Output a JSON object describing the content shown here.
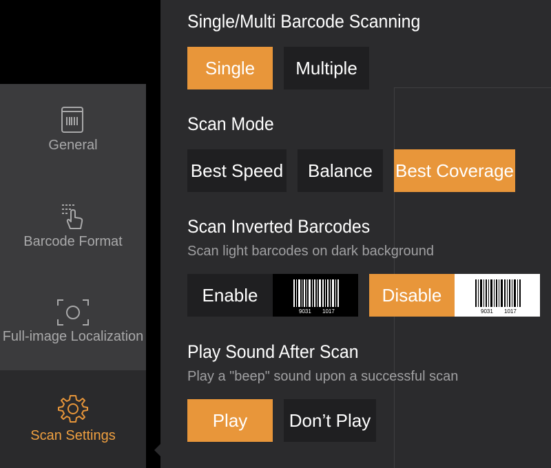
{
  "sidebar": {
    "items": [
      {
        "label": "General",
        "icon": "book-icon"
      },
      {
        "label": "Barcode Format",
        "icon": "tap-barcode-icon"
      },
      {
        "label": "Full-image Localization",
        "icon": "focus-frame-icon"
      },
      {
        "label": "Scan Settings",
        "icon": "gear-icon",
        "active": true
      }
    ]
  },
  "colors": {
    "accent": "#e8963a",
    "button_bg": "#1f1f21",
    "panel_bg": "#2b2b2d",
    "sidebar_bg": "#3b3b3d"
  },
  "sections": {
    "scanning": {
      "title": "Single/Multi Barcode Scanning",
      "options": [
        "Single",
        "Multiple"
      ],
      "selected": "Single"
    },
    "scan_mode": {
      "title": "Scan Mode",
      "options": [
        "Best Speed",
        "Balance",
        "Best Coverage"
      ],
      "selected": "Best Coverage"
    },
    "inverted": {
      "title": "Scan Inverted Barcodes",
      "subtitle": "Scan light barcodes on dark background",
      "options": [
        "Enable",
        "Disable"
      ],
      "selected": "Disable",
      "barcode_number_left": "9031",
      "barcode_number_right": "1017"
    },
    "sound": {
      "title": "Play Sound After Scan",
      "subtitle": "Play a \"beep\" sound upon a successful scan",
      "options": [
        "Play",
        "Don’t Play"
      ],
      "selected": "Play"
    }
  }
}
